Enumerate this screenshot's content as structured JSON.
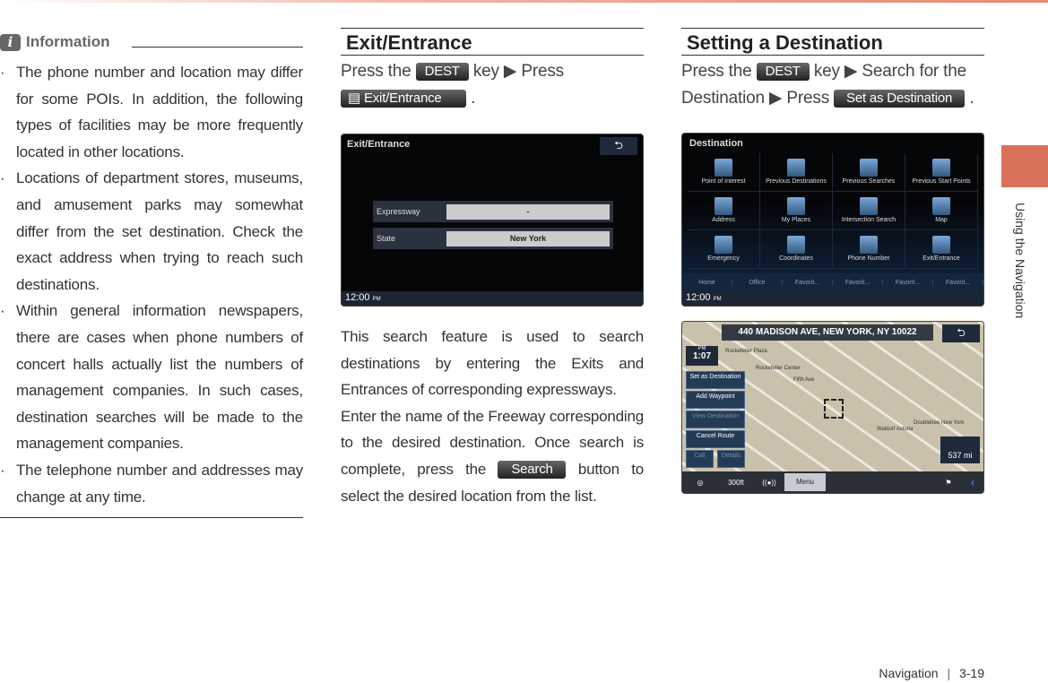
{
  "info": {
    "icon": "info-icon",
    "title": "Information",
    "bullets": [
      "The phone number and location may differ for some POIs. In addition, the following types of facilities may be more frequently located in other locations.",
      "Locations of department stores, museums, and amusement parks may somewhat differ from the set destination. Check the exact address when trying to reach such destinations.",
      "Within general information newspapers, there are cases when phone numbers of concert halls actually list the numbers of management companies. In such cases, destination searches will be made to the management companies.",
      "The telephone number and addresses may change at any time."
    ]
  },
  "exit": {
    "title": "Exit/Entrance",
    "press": "Press the",
    "dest_key": "DEST",
    "key_press": "key ▶ Press",
    "button": "Exit/Entrance",
    "period": ".",
    "screen": {
      "title": "Exit/Entrance",
      "rows": [
        {
          "label": "Expressway",
          "value": "-"
        },
        {
          "label": "State",
          "value": "New York"
        }
      ],
      "clock": "12:00",
      "ampm": "PM"
    },
    "body1": "This search feature is used to search destinations by entering the Exits and Entrances of corresponding expressways.",
    "body2": "Enter the name of the Freeway corresponding to the desired destination. Once search is complete, press the",
    "search_button": "Search",
    "body3": "button to select the desired location from the list."
  },
  "dest": {
    "title": "Setting a Destination",
    "press": "Press the",
    "dest_key": "DEST",
    "key_text": "key ▶ Search for the Destination ▶ Press",
    "button": "Set as Destination",
    "period": ".",
    "screen": {
      "title": "Destination",
      "items": [
        "Point of Interest",
        "Previous Destinations",
        "Previous Searches",
        "Previous Start Points",
        "Address",
        "My Places",
        "Intersection Search",
        "Map",
        "Emergency",
        "Coordinates",
        "Phone Number",
        "Exit/Entrance"
      ],
      "favorites": [
        "Home",
        "Office",
        "Favorit...",
        "Favorit...",
        "Favorit...",
        "Favorit..."
      ],
      "clock": "12:00",
      "ampm": "PM"
    },
    "map": {
      "address": "440 MADISON AVE, NEW YORK, NY 10022",
      "ampm": "PM",
      "time": "1:07",
      "buttons": [
        "Set as Destination",
        "Add Waypoint",
        "View Destination",
        "Cancel Route"
      ],
      "call": "Call",
      "details": "Details",
      "distance": "537 mi",
      "scale": "300ft",
      "menu": "Menu",
      "pois": [
        "Rockefeller Plaza",
        "Rockefeller Center",
        "Fifth Ave",
        "Waldorf Astoria",
        "Doubletree New York"
      ]
    }
  },
  "sidebar": {
    "section": "Using the Navigation",
    "accent": "#d9705a"
  },
  "footer": {
    "section": "Navigation",
    "page": "3-19"
  }
}
